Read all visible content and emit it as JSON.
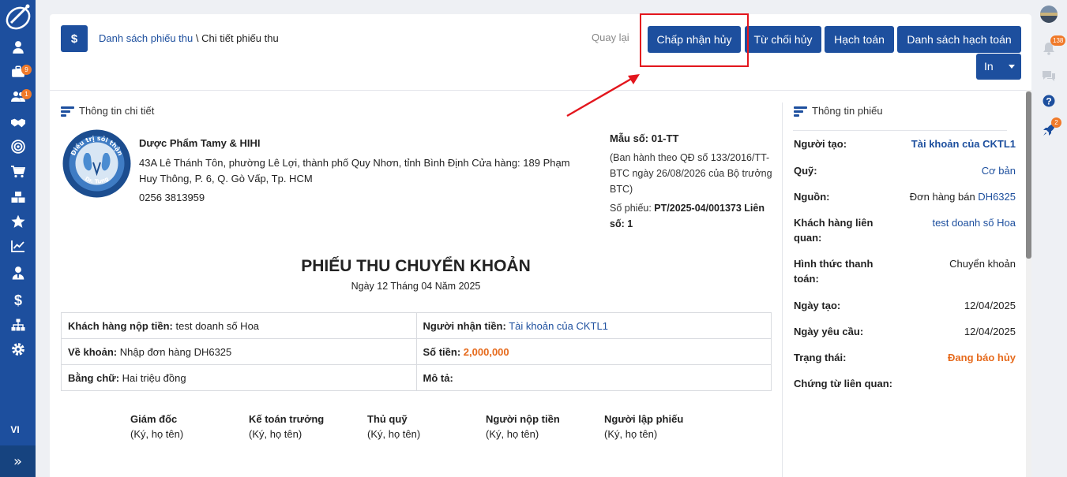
{
  "sidebar": {
    "items": [
      {
        "icon": "user-icon"
      },
      {
        "icon": "briefcase-icon",
        "badge": "9"
      },
      {
        "icon": "users-icon",
        "badge": "1"
      },
      {
        "icon": "handshake-icon"
      },
      {
        "icon": "target-icon"
      },
      {
        "icon": "cart-icon"
      },
      {
        "icon": "boxes-icon"
      },
      {
        "icon": "star-icon"
      },
      {
        "icon": "chart-line-icon"
      },
      {
        "icon": "user-tie-icon"
      },
      {
        "icon": "dollar-icon"
      },
      {
        "icon": "sitemap-icon"
      },
      {
        "icon": "gear-icon"
      }
    ],
    "language": "VI",
    "expand_glyph": "»"
  },
  "rail": {
    "notification_badge": "138",
    "rocket_badge": "2"
  },
  "header": {
    "breadcrumb_link": "Danh sách phiếu thu",
    "breadcrumb_sep": " \\ ",
    "breadcrumb_current": "Chi tiết phiếu thu",
    "back": "Quay lại",
    "buttons": {
      "accept_cancel": "Chấp nhận hủy",
      "reject_cancel": "Từ chối hủy",
      "accounting": "Hạch toán",
      "accounting_list": "Danh sách hạch toán",
      "print": "In"
    }
  },
  "detail": {
    "section_title": "Thông tin chi tiết",
    "logo_text_top": "Điều trị sỏi thận",
    "logo_text_bottom": "Dr. Tung",
    "company_name": "Dược Phẩm Tamy & HIHI",
    "address": "43A Lê Thánh Tôn, phường Lê Lợi, thành phố Quy Nhơn, tỉnh Bình Định Cửa hàng: 189 Phạm Huy Thông, P. 6, Q. Gò Vấp, Tp. HCM",
    "phone": "0256 3813959",
    "form_no": "Mẫu số: 01-TT",
    "regulation": "(Ban hành theo QĐ số 133/2016/TT-BTC ngày 26/08/2026 của Bộ trưởng BTC)",
    "receipt_no_label": "Số phiếu: ",
    "receipt_no": "PT/2025-04/001373 Liên số: 1",
    "doc_title": "PHIẾU THU CHUYỂN KHOẢN",
    "doc_date": "Ngày 12 Tháng 04 Năm 2025",
    "table": {
      "payer_label": "Khách hàng nộp tiền:",
      "payer": "test doanh số Hoa",
      "receiver_label": "Người nhận tiền:",
      "receiver": "Tài khoản của CKTL1",
      "reason_label": "Về khoản:",
      "reason": "Nhập đơn hàng DH6325",
      "amount_label": "Số tiền:",
      "amount": "2,000,000",
      "in_words_label": "Bằng chữ:",
      "in_words": "Hai triệu đồng",
      "description_label": "Mô tả:",
      "description": ""
    },
    "signatures": [
      {
        "title": "Giám đốc",
        "sub": "(Ký, họ tên)"
      },
      {
        "title": "Kế toán trưởng",
        "sub": "(Ký, họ tên)"
      },
      {
        "title": "Thủ quỹ",
        "sub": "(Ký, họ tên)"
      },
      {
        "title": "Người nộp tiền",
        "sub": "(Ký, họ tên)"
      },
      {
        "title": "Người lập phiếu",
        "sub": "(Ký, họ tên)"
      }
    ]
  },
  "receipt_info": {
    "section_title": "Thông tin phiếu",
    "creator_label": "Người tạo:",
    "creator": "Tài khoản của CKTL1",
    "fund_label": "Quỹ:",
    "fund": "Cơ bản",
    "source_label": "Nguồn:",
    "source_prefix": "Đơn hàng bán ",
    "source_link": "DH6325",
    "customer_label": "Khách hàng liên quan:",
    "customer": "test doanh số Hoa",
    "payment_method_label": "Hình thức thanh toán:",
    "payment_method": "Chuyển khoản",
    "created_date_label": "Ngày tạo:",
    "created_date": "12/04/2025",
    "request_date_label": "Ngày yêu cầu:",
    "request_date": "12/04/2025",
    "status_label": "Trạng thái:",
    "status": "Đang báo hủy",
    "related_docs_label": "Chứng từ liên quan:",
    "related_docs": ""
  },
  "colors": {
    "primary": "#1d4f9e",
    "status_orange": "#e66a1c",
    "highlight_red": "#e3161d",
    "badge_orange": "#f07a2a"
  }
}
